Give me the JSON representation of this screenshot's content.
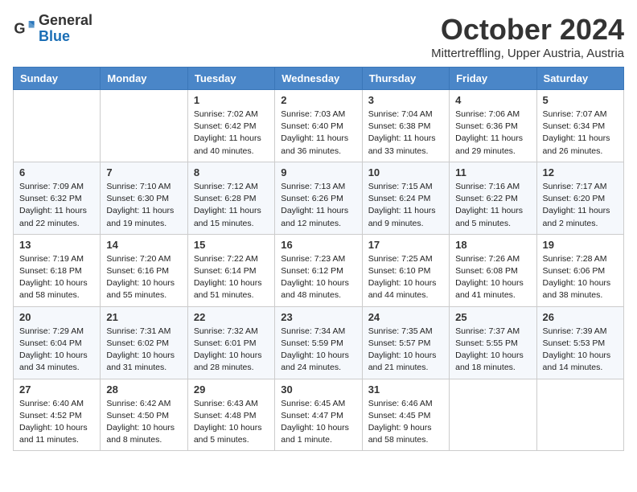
{
  "header": {
    "logo_general": "General",
    "logo_blue": "Blue",
    "month_title": "October 2024",
    "subtitle": "Mittertreffling, Upper Austria, Austria"
  },
  "weekdays": [
    "Sunday",
    "Monday",
    "Tuesday",
    "Wednesday",
    "Thursday",
    "Friday",
    "Saturday"
  ],
  "weeks": [
    [
      {
        "day": "",
        "info": ""
      },
      {
        "day": "",
        "info": ""
      },
      {
        "day": "1",
        "info": "Sunrise: 7:02 AM\nSunset: 6:42 PM\nDaylight: 11 hours and 40 minutes."
      },
      {
        "day": "2",
        "info": "Sunrise: 7:03 AM\nSunset: 6:40 PM\nDaylight: 11 hours and 36 minutes."
      },
      {
        "day": "3",
        "info": "Sunrise: 7:04 AM\nSunset: 6:38 PM\nDaylight: 11 hours and 33 minutes."
      },
      {
        "day": "4",
        "info": "Sunrise: 7:06 AM\nSunset: 6:36 PM\nDaylight: 11 hours and 29 minutes."
      },
      {
        "day": "5",
        "info": "Sunrise: 7:07 AM\nSunset: 6:34 PM\nDaylight: 11 hours and 26 minutes."
      }
    ],
    [
      {
        "day": "6",
        "info": "Sunrise: 7:09 AM\nSunset: 6:32 PM\nDaylight: 11 hours and 22 minutes."
      },
      {
        "day": "7",
        "info": "Sunrise: 7:10 AM\nSunset: 6:30 PM\nDaylight: 11 hours and 19 minutes."
      },
      {
        "day": "8",
        "info": "Sunrise: 7:12 AM\nSunset: 6:28 PM\nDaylight: 11 hours and 15 minutes."
      },
      {
        "day": "9",
        "info": "Sunrise: 7:13 AM\nSunset: 6:26 PM\nDaylight: 11 hours and 12 minutes."
      },
      {
        "day": "10",
        "info": "Sunrise: 7:15 AM\nSunset: 6:24 PM\nDaylight: 11 hours and 9 minutes."
      },
      {
        "day": "11",
        "info": "Sunrise: 7:16 AM\nSunset: 6:22 PM\nDaylight: 11 hours and 5 minutes."
      },
      {
        "day": "12",
        "info": "Sunrise: 7:17 AM\nSunset: 6:20 PM\nDaylight: 11 hours and 2 minutes."
      }
    ],
    [
      {
        "day": "13",
        "info": "Sunrise: 7:19 AM\nSunset: 6:18 PM\nDaylight: 10 hours and 58 minutes."
      },
      {
        "day": "14",
        "info": "Sunrise: 7:20 AM\nSunset: 6:16 PM\nDaylight: 10 hours and 55 minutes."
      },
      {
        "day": "15",
        "info": "Sunrise: 7:22 AM\nSunset: 6:14 PM\nDaylight: 10 hours and 51 minutes."
      },
      {
        "day": "16",
        "info": "Sunrise: 7:23 AM\nSunset: 6:12 PM\nDaylight: 10 hours and 48 minutes."
      },
      {
        "day": "17",
        "info": "Sunrise: 7:25 AM\nSunset: 6:10 PM\nDaylight: 10 hours and 44 minutes."
      },
      {
        "day": "18",
        "info": "Sunrise: 7:26 AM\nSunset: 6:08 PM\nDaylight: 10 hours and 41 minutes."
      },
      {
        "day": "19",
        "info": "Sunrise: 7:28 AM\nSunset: 6:06 PM\nDaylight: 10 hours and 38 minutes."
      }
    ],
    [
      {
        "day": "20",
        "info": "Sunrise: 7:29 AM\nSunset: 6:04 PM\nDaylight: 10 hours and 34 minutes."
      },
      {
        "day": "21",
        "info": "Sunrise: 7:31 AM\nSunset: 6:02 PM\nDaylight: 10 hours and 31 minutes."
      },
      {
        "day": "22",
        "info": "Sunrise: 7:32 AM\nSunset: 6:01 PM\nDaylight: 10 hours and 28 minutes."
      },
      {
        "day": "23",
        "info": "Sunrise: 7:34 AM\nSunset: 5:59 PM\nDaylight: 10 hours and 24 minutes."
      },
      {
        "day": "24",
        "info": "Sunrise: 7:35 AM\nSunset: 5:57 PM\nDaylight: 10 hours and 21 minutes."
      },
      {
        "day": "25",
        "info": "Sunrise: 7:37 AM\nSunset: 5:55 PM\nDaylight: 10 hours and 18 minutes."
      },
      {
        "day": "26",
        "info": "Sunrise: 7:39 AM\nSunset: 5:53 PM\nDaylight: 10 hours and 14 minutes."
      }
    ],
    [
      {
        "day": "27",
        "info": "Sunrise: 6:40 AM\nSunset: 4:52 PM\nDaylight: 10 hours and 11 minutes."
      },
      {
        "day": "28",
        "info": "Sunrise: 6:42 AM\nSunset: 4:50 PM\nDaylight: 10 hours and 8 minutes."
      },
      {
        "day": "29",
        "info": "Sunrise: 6:43 AM\nSunset: 4:48 PM\nDaylight: 10 hours and 5 minutes."
      },
      {
        "day": "30",
        "info": "Sunrise: 6:45 AM\nSunset: 4:47 PM\nDaylight: 10 hours and 1 minute."
      },
      {
        "day": "31",
        "info": "Sunrise: 6:46 AM\nSunset: 4:45 PM\nDaylight: 9 hours and 58 minutes."
      },
      {
        "day": "",
        "info": ""
      },
      {
        "day": "",
        "info": ""
      }
    ]
  ]
}
